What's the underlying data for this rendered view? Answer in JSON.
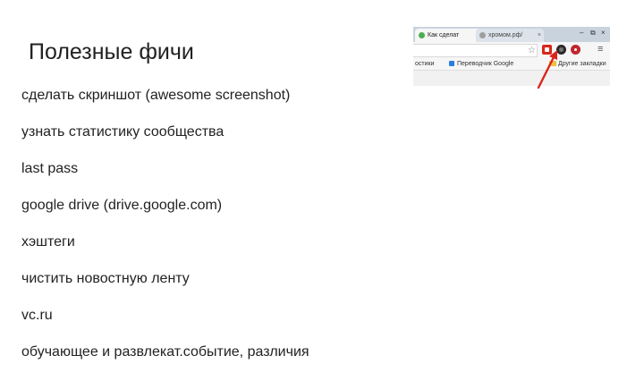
{
  "slide": {
    "title": "Полезные фичи",
    "bullets": [
      "сделать скриншот (awesome screenshot)",
      "узнать статистику сообщества",
      "last pass",
      "google drive (drive.google.com)",
      "хэштеги",
      "чистить новостную ленту",
      "vc.ru",
      "обучающее и развлекат.событие, различия"
    ]
  },
  "browser": {
    "tabs": [
      {
        "label": "Как сделат",
        "favicon_color": "#4caf50"
      },
      {
        "label": "хромом.рф/",
        "favicon_color": "#9e9e9e"
      }
    ],
    "tab_close_icon": "close-icon",
    "window_controls": [
      "–",
      "⧉",
      "×"
    ],
    "bookmarks": {
      "item1": "остики",
      "item2": "Переводчик Google",
      "item3": "Другие закладки"
    },
    "extension_icons": [
      "awesome-screenshot-icon",
      "extension-dark-icon",
      "lastpass-icon"
    ],
    "menu_icon": "≡",
    "star_icon": "☆"
  },
  "annotation": {
    "arrow_color": "#d9261c"
  }
}
